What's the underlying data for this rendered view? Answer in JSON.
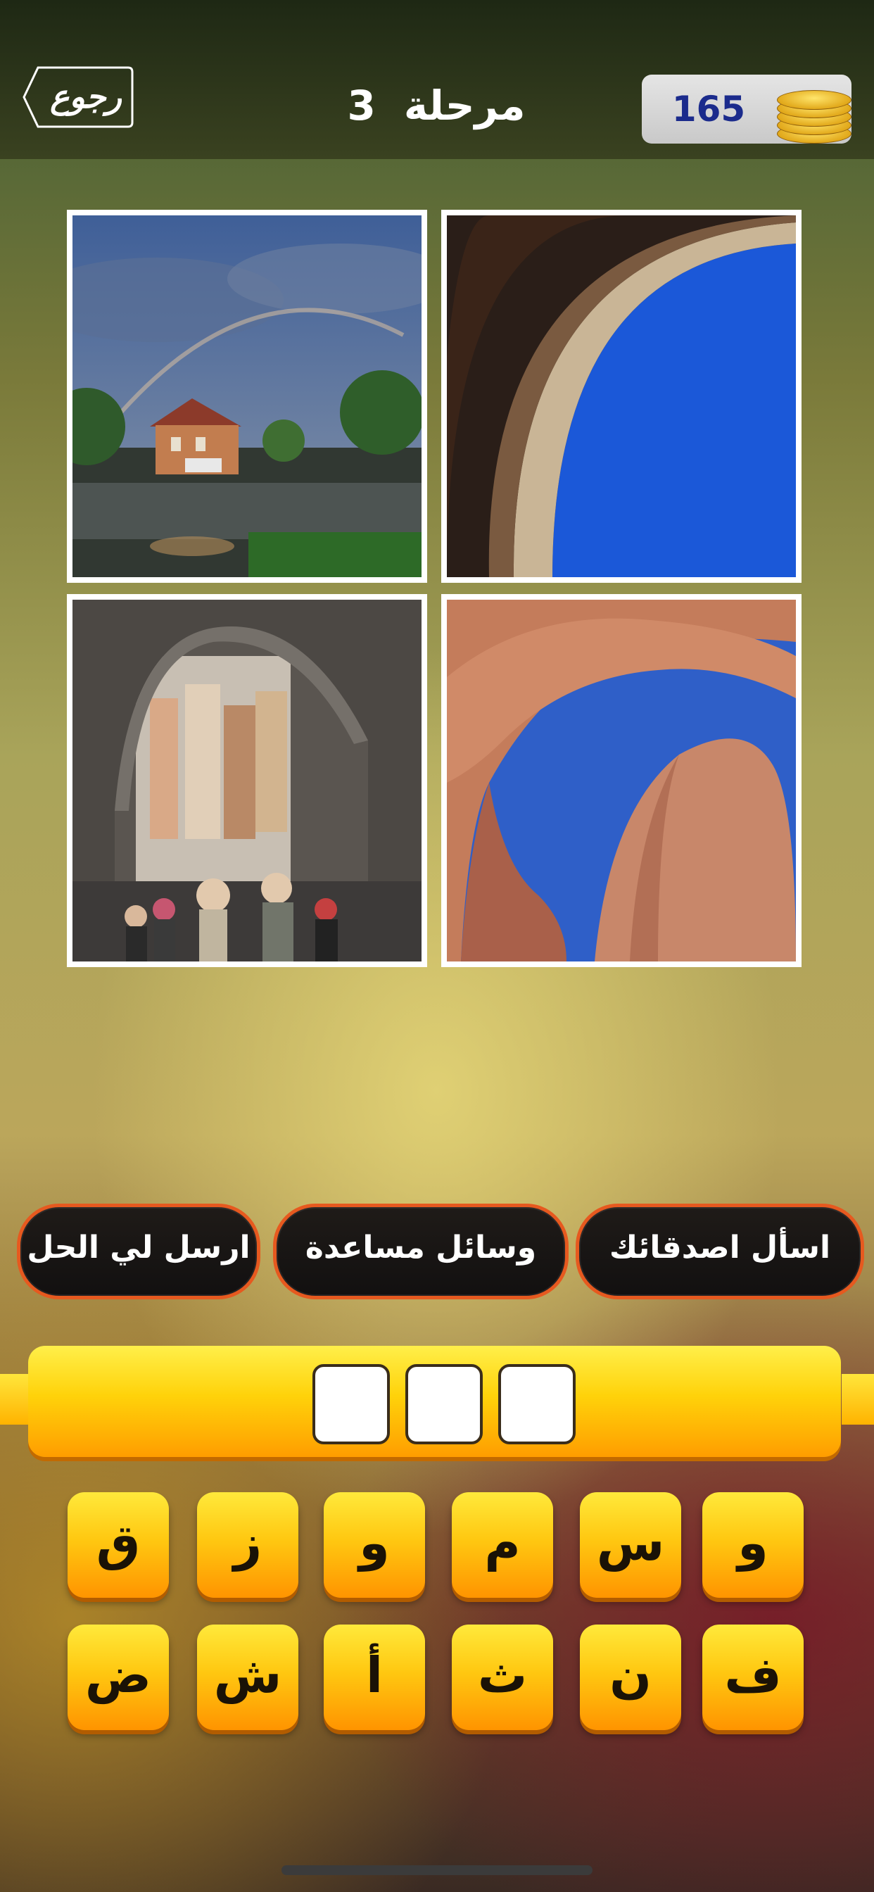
{
  "header": {
    "back_label": "رجوع",
    "level_word": "مرحلة",
    "level_number": "3",
    "coins": "165"
  },
  "photos": [
    {
      "name": "rainbow-house-photo"
    },
    {
      "name": "arch-sky-photo"
    },
    {
      "name": "street-archway-photo"
    },
    {
      "name": "rock-arch-photo"
    }
  ],
  "hints": {
    "ask_friends": "اسأل اصدقائك",
    "help_tools": "وسائل مساعدة",
    "send_solution": "ارسل لي الحل"
  },
  "answer": {
    "slots": [
      "",
      "",
      ""
    ]
  },
  "keyboard": {
    "row1": [
      "و",
      "س",
      "م",
      "و",
      "ز",
      "ق"
    ],
    "row2": [
      "ف",
      "ن",
      "ث",
      "أ",
      "ش",
      "ض"
    ]
  },
  "colors": {
    "accent": "#ffc811",
    "hint_border": "#e6591f",
    "coins_text": "#1b2b8c"
  }
}
